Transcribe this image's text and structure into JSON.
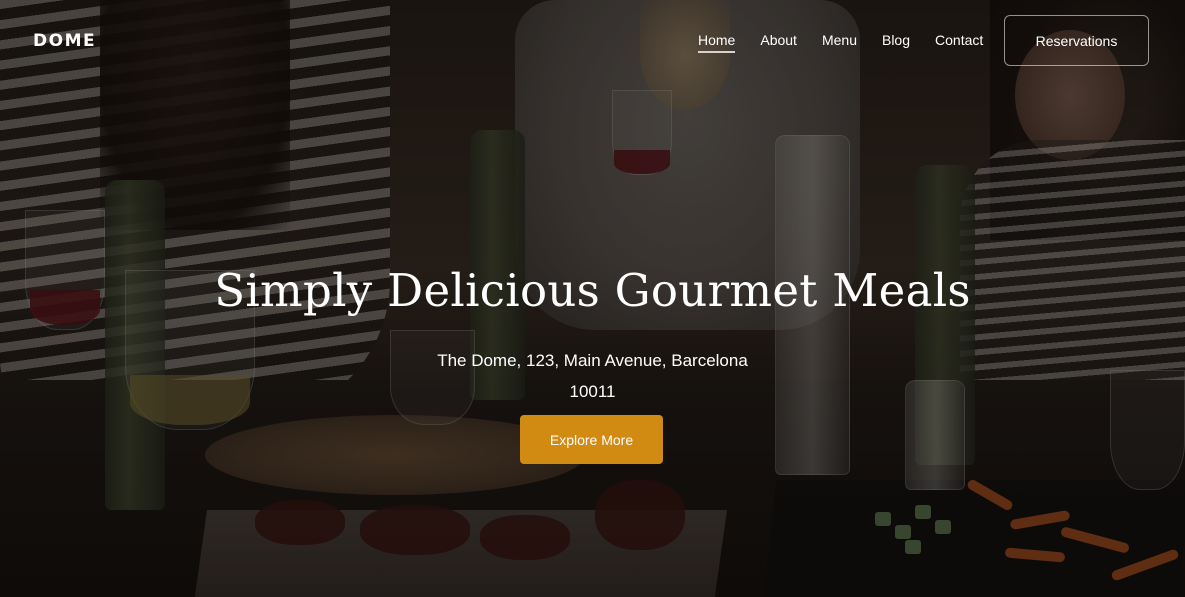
{
  "brand": {
    "logo_text": "DOME"
  },
  "nav": {
    "items": [
      {
        "label": "Home",
        "active": true
      },
      {
        "label": "About",
        "active": false
      },
      {
        "label": "Menu",
        "active": false
      },
      {
        "label": "Blog",
        "active": false
      },
      {
        "label": "Contact",
        "active": false
      }
    ],
    "reservations_label": "Reservations"
  },
  "hero": {
    "title": "Simply Delicious Gourmet Meals",
    "address_line1": "The Dome, 123, Main Avenue, Barcelona",
    "address_line2": "10011",
    "cta_label": "Explore More",
    "background": "restaurant dinner table photo"
  },
  "colors": {
    "accent": "#d18a12",
    "text": "#ffffff",
    "overlay": "rgba(0,0,0,0.38)"
  }
}
